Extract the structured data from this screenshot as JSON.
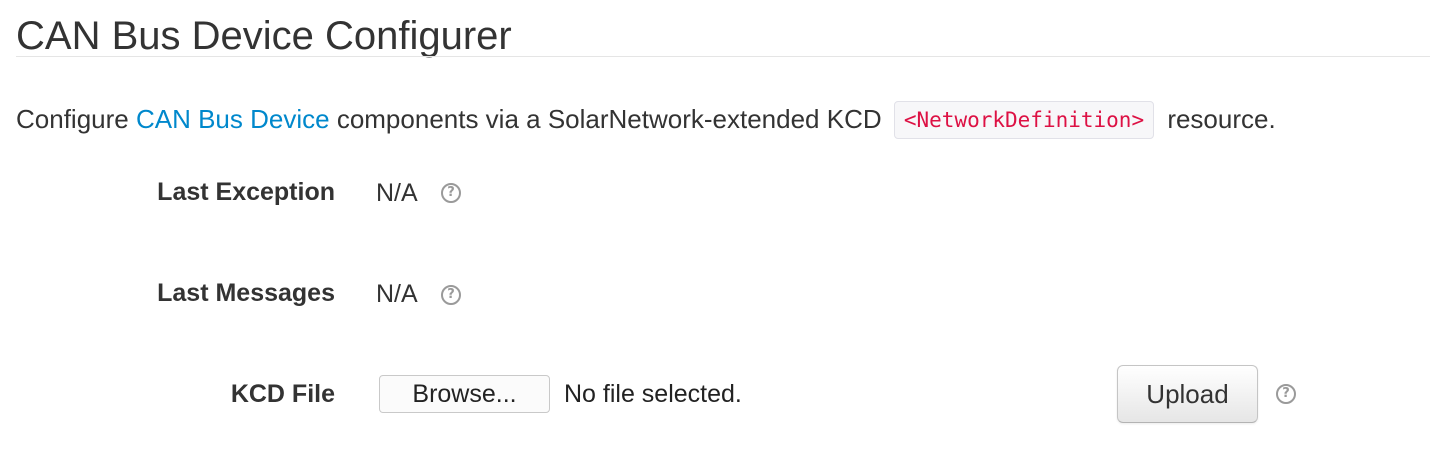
{
  "page": {
    "title": "CAN Bus Device Configurer"
  },
  "intro": {
    "prefix": "Configure ",
    "link_text": "CAN Bus Device",
    "middle": " components via a SolarNetwork-extended KCD ",
    "code": "<NetworkDefinition>",
    "suffix": " resource."
  },
  "fields": {
    "last_exception": {
      "label": "Last Exception",
      "value": "N/A",
      "help_icon": "question-circle-icon"
    },
    "last_messages": {
      "label": "Last Messages",
      "value": "N/A",
      "help_icon": "question-circle-icon"
    },
    "kcd_file": {
      "label": "KCD File",
      "browse_label": "Browse...",
      "file_status": "No file selected.",
      "upload_label": "Upload",
      "help_icon": "question-circle-icon"
    }
  },
  "help_glyph": "?",
  "colors": {
    "text": "#333333",
    "link": "#0088cc",
    "code_text": "#dd1144",
    "code_bg": "#f7f7f9",
    "help_icon": "#9a9a9a"
  }
}
